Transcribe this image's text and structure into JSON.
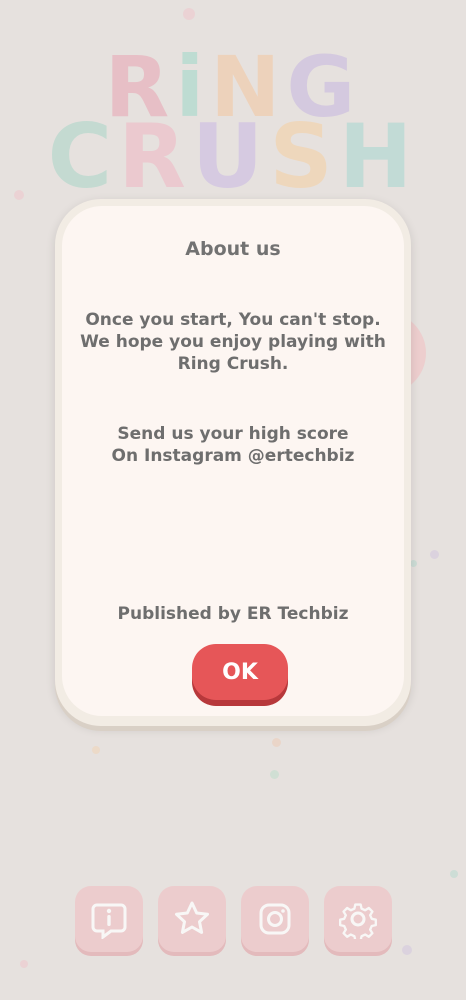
{
  "logo": {
    "line1": [
      "R",
      "i",
      "N",
      "G"
    ],
    "line2": [
      "C",
      "R",
      "U",
      "S",
      "H"
    ],
    "line1_colors": [
      "#e9a5b3",
      "#9fd8c9",
      "#f4c7a0",
      "#c7b6e0"
    ],
    "line2_colors": [
      "#a9d6c8",
      "#f0b6c4",
      "#c9b8e5",
      "#f6cfa1",
      "#a6d7d0"
    ]
  },
  "dialog": {
    "title": "About us",
    "paragraph1": [
      "Once you start, You can't stop.",
      "We hope you enjoy playing with",
      "Ring Crush."
    ],
    "paragraph2": [
      "Send us your high score",
      "On Instagram @ertechbiz"
    ],
    "published": "Published by ER Techbiz",
    "ok_label": "OK"
  },
  "bottom_bar": {
    "buttons": [
      "info-icon",
      "rate-star-icon",
      "instagram-icon",
      "settings-gear-icon"
    ]
  },
  "colors": {
    "background": "#e6e1de",
    "ok_button": "#e65658",
    "bottom_button": "#efc6c8"
  }
}
